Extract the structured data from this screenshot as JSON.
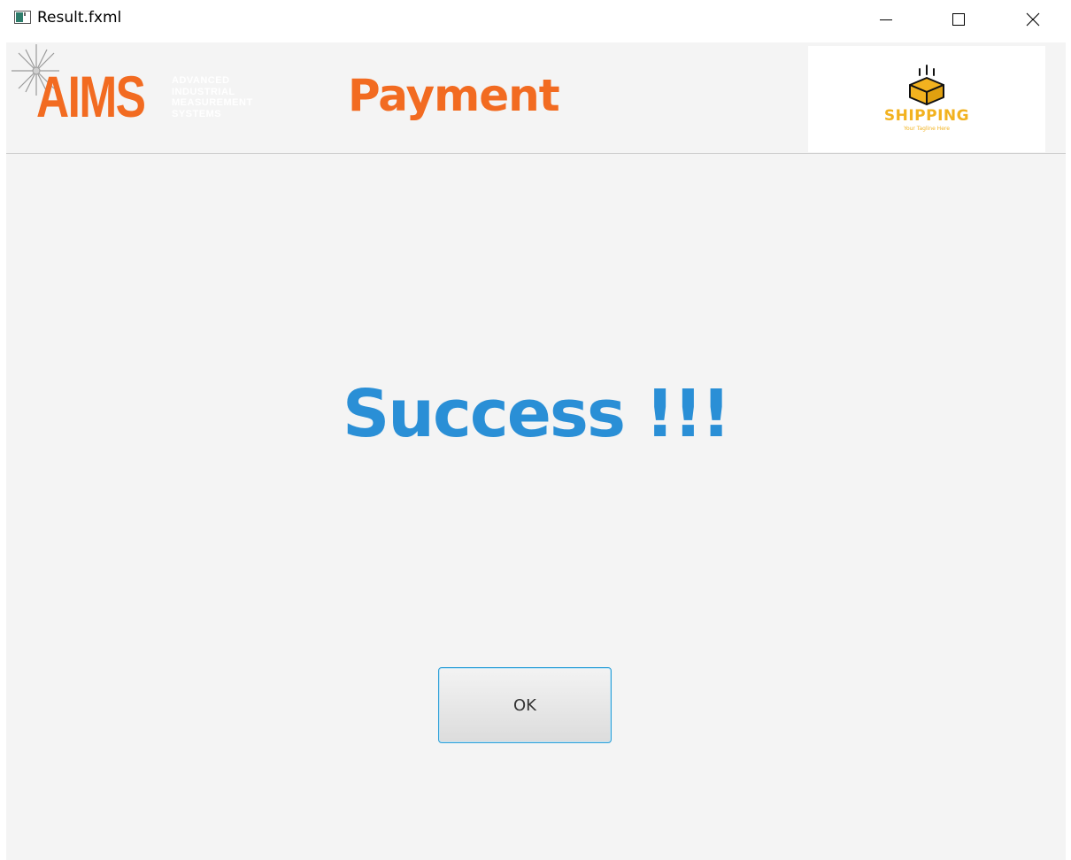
{
  "window": {
    "title": "Result.fxml",
    "icon": "app-window-icon"
  },
  "header": {
    "aims_logo": {
      "letters": "AIMS",
      "lines": [
        "ADVANCED",
        "INDUSTRIAL",
        "MEASUREMENT",
        "SYSTEMS"
      ],
      "color": "#f26b21"
    },
    "page_title": "Payment",
    "shipping_logo": {
      "text": "SHIPPING",
      "tagline": "Your Tagline Here",
      "color": "#f2b21f"
    }
  },
  "main": {
    "message": "Success !!!",
    "message_color": "#2a8fd6",
    "ok_label": "OK"
  }
}
